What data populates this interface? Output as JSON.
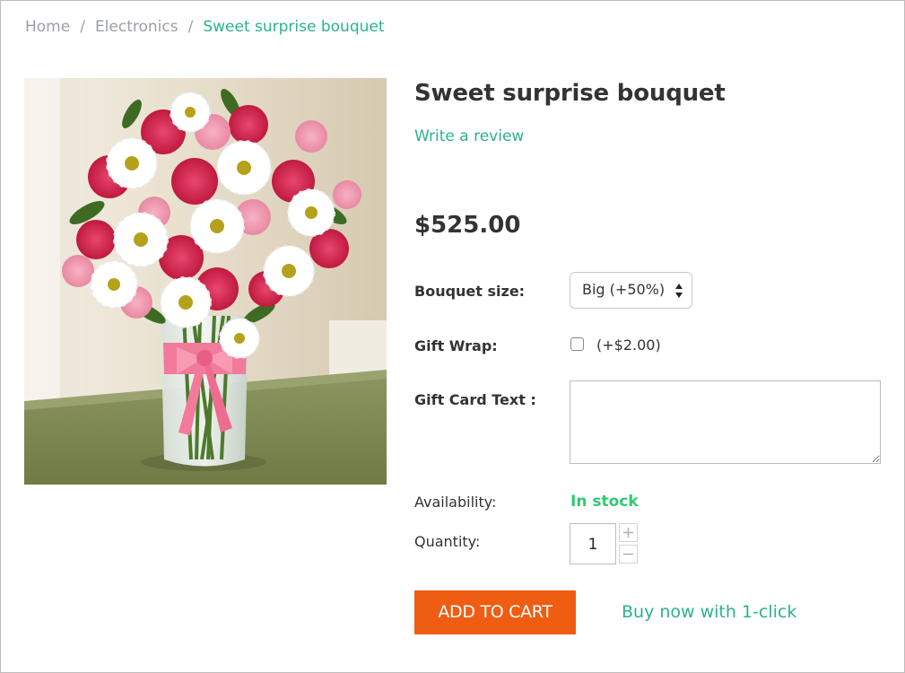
{
  "breadcrumb": {
    "items": [
      "Home",
      "Electronics"
    ],
    "separator": "/",
    "current": "Sweet surprise bouquet"
  },
  "product": {
    "image_alt": "Bouquet of pink carnations and white daisies in a glass vase with a pink ribbon",
    "title": "Sweet surprise bouquet",
    "review_link": "Write a review",
    "price": "$525.00"
  },
  "options": {
    "bouquet_size": {
      "label": "Bouquet size:",
      "selected": "Big (+50%)"
    },
    "gift_wrap": {
      "label": "Gift Wrap:",
      "checked": false,
      "price": "(+$2.00)"
    },
    "gift_card_text": {
      "label": "Gift Card Text :",
      "value": ""
    }
  },
  "availability": {
    "label": "Availability:",
    "value": "In stock"
  },
  "quantity": {
    "label": "Quantity:",
    "value": "1"
  },
  "actions": {
    "add_to_cart": "ADD TO CART",
    "buy_now": "Buy now with 1-click"
  },
  "colors": {
    "accent_green": "#2bb38a",
    "stock_green": "#2ecc71",
    "cart_orange": "#ee5d12"
  },
  "icons": [
    "select-arrows-icon",
    "plus-icon",
    "minus-icon"
  ]
}
